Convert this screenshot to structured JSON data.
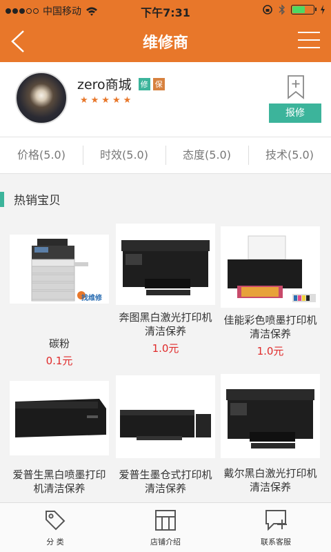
{
  "status_bar": {
    "carrier": "中国移动",
    "time": "下午7:31"
  },
  "nav": {
    "title": "维修商"
  },
  "shop": {
    "name": "zero商城",
    "badge_repair": "修",
    "badge_guarantee": "保",
    "stars": "★★★★★",
    "report_button": "报修"
  },
  "ratings": [
    {
      "label": "价格(5.0)"
    },
    {
      "label": "时效(5.0)"
    },
    {
      "label": "态度(5.0)"
    },
    {
      "label": "技术(5.0)"
    }
  ],
  "section": {
    "title": "热销宝贝"
  },
  "products": [
    {
      "name": "碳粉",
      "price": "0.1元"
    },
    {
      "name": "奔图黑白激光打印机清洁保养",
      "price": "1.0元"
    },
    {
      "name": "佳能彩色喷墨打印机清洁保养",
      "price": "1.0元"
    },
    {
      "name": "爱普生黑白喷墨打印机清洁保养",
      "price": ""
    },
    {
      "name": "爱普生墨仓式打印机清洁保养",
      "price": ""
    },
    {
      "name": "戴尔黑白激光打印机清洁保养",
      "price": ""
    }
  ],
  "watermark": "找维修",
  "tabs": [
    {
      "label": "分 类",
      "icon": "tag-icon"
    },
    {
      "label": "店铺介绍",
      "icon": "store-icon"
    },
    {
      "label": "联系客服",
      "icon": "chat-plus-icon"
    }
  ],
  "colors": {
    "brand_orange": "#e8772a",
    "accent_green": "#3cb49b",
    "price_red": "#e02a2a"
  }
}
